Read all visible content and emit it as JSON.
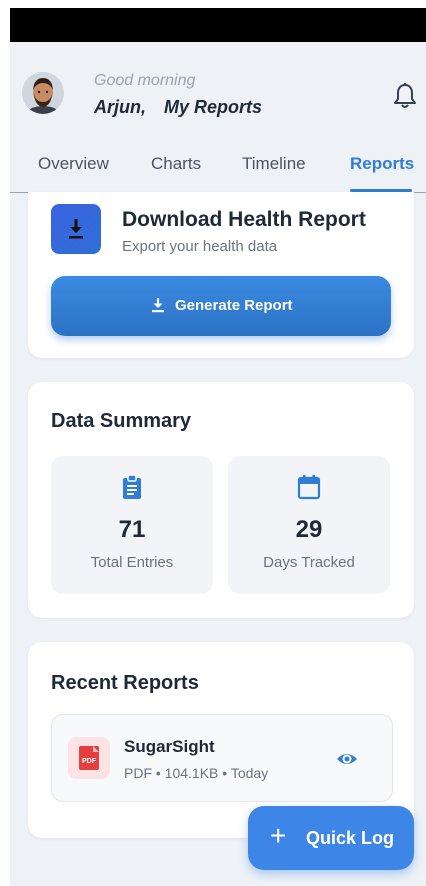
{
  "header": {
    "greeting": "Good morning",
    "user_name": "Arjun,",
    "page_title": "My Reports"
  },
  "tabs": [
    {
      "label": "Overview",
      "active": false
    },
    {
      "label": "Charts",
      "active": false
    },
    {
      "label": "Timeline",
      "active": false
    },
    {
      "label": "Reports",
      "active": true
    }
  ],
  "download_card": {
    "title": "Download Health Report",
    "subtitle": "Export your health data",
    "button_label": "Generate Report",
    "icon": "download-icon"
  },
  "summary": {
    "title": "Data Summary",
    "stats": [
      {
        "value": "71",
        "label": "Total Entries",
        "icon": "clipboard-icon"
      },
      {
        "value": "29",
        "label": "Days Tracked",
        "icon": "calendar-icon"
      }
    ]
  },
  "recent": {
    "title": "Recent Reports",
    "items": [
      {
        "name": "SugarSight",
        "meta": "PDF • 104.1KB • Today",
        "badge": "PDF",
        "icon": "pdf-file-icon",
        "action_icon": "eye-icon"
      }
    ]
  },
  "fab": {
    "label": "Quick Log",
    "icon": "plus-icon"
  },
  "colors": {
    "accent": "#2f7dd4",
    "background": "#eef2f6",
    "card": "#ffffff",
    "pdf_red": "#e53e3e"
  }
}
